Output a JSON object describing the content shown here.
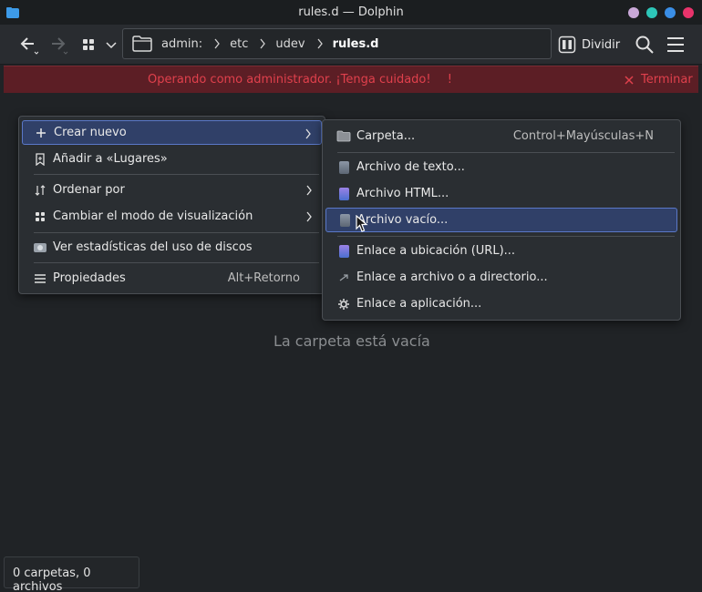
{
  "window": {
    "title": "rules.d — Dolphin",
    "buttons": {
      "minimize_color": "#c9a8d8",
      "maximize_color": "#2dc6b8",
      "restore_color": "#3a8ee6",
      "close_color": "#e8336b"
    }
  },
  "toolbar": {
    "back_icon": "arrow-left-icon",
    "forward_icon": "arrow-right-icon",
    "view_mode_icon": "grid-icon",
    "breadcrumbs": [
      "admin:",
      "etc",
      "udev",
      "rules.d"
    ],
    "split_label": "Dividir",
    "search_icon": "search-icon",
    "menu_icon": "hamburger-icon"
  },
  "banner": {
    "message": "Operando como administrador. ¡Tenga cuidado!",
    "close_label": "Terminar",
    "color": "#e0404c"
  },
  "content": {
    "empty_message": "La carpeta está vacía"
  },
  "status": {
    "text": "0 carpetas, 0 archivos"
  },
  "context_menu": {
    "items": [
      {
        "label": "Crear nuevo",
        "icon": "plus-icon"
      },
      {
        "label": "Añadir a «Lugares»",
        "icon": "bookmark-icon"
      },
      {
        "label": "Ordenar por",
        "icon": "sort-icon"
      },
      {
        "label": "Cambiar el modo de visualización",
        "icon": "grid-icon"
      },
      {
        "label": "Ver estadísticas del uso de discos",
        "icon": "disk-icon"
      },
      {
        "label": "Propiedades",
        "icon": "list-icon",
        "shortcut": "Alt+Retorno"
      }
    ]
  },
  "submenu": {
    "items": [
      {
        "label": "Carpeta...",
        "icon": "folder-icon",
        "shortcut": "Control+Mayúsculas+N"
      },
      {
        "label": "Archivo de texto...",
        "icon": "text-file-icon"
      },
      {
        "label": "Archivo HTML...",
        "icon": "html-file-icon"
      },
      {
        "label": "Archivo vacío...",
        "icon": "empty-file-icon"
      },
      {
        "label": "Enlace a ubicación (URL)...",
        "icon": "url-link-icon"
      },
      {
        "label": "Enlace a archivo o a directorio...",
        "icon": "file-link-icon"
      },
      {
        "label": "Enlace a aplicación...",
        "icon": "gear-icon"
      }
    ]
  }
}
